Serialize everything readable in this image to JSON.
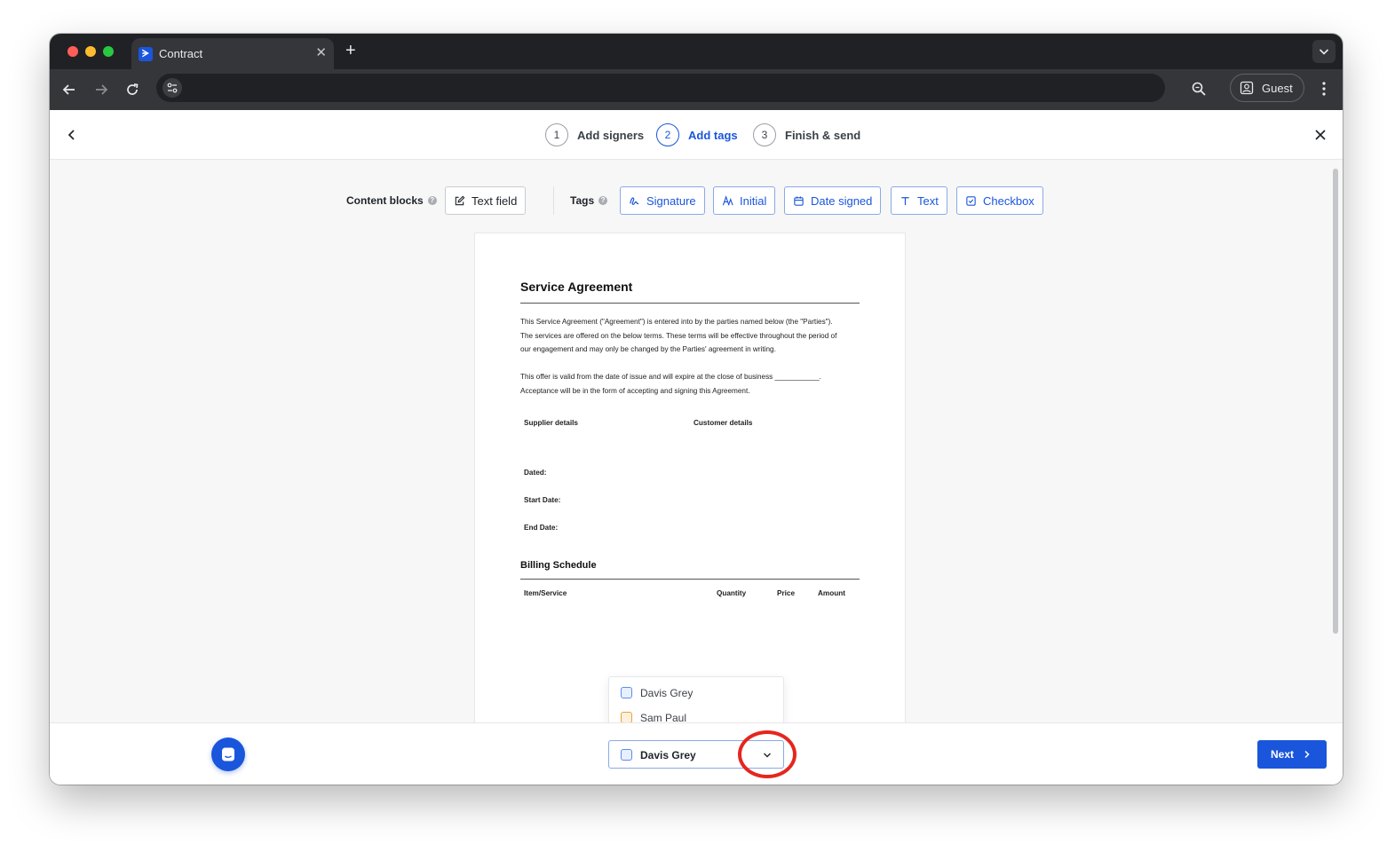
{
  "browser": {
    "tab_title": "Contract",
    "profile_label": "Guest",
    "close_glyph": "✕",
    "newtab_glyph": "+",
    "favicon_glyph": "ᗒ"
  },
  "wizard": {
    "steps": [
      {
        "number": "1",
        "label": "Add signers"
      },
      {
        "number": "2",
        "label": "Add tags"
      },
      {
        "number": "3",
        "label": "Finish & send"
      }
    ],
    "active_step": 2
  },
  "blocks": {
    "content_blocks_label": "Content blocks",
    "tags_label": "Tags",
    "help_glyph": "?",
    "text_field": "Text field",
    "signature": "Signature",
    "initial": "Initial",
    "date_signed": "Date signed",
    "text": "Text",
    "checkbox": "Checkbox"
  },
  "document": {
    "title": "Service Agreement",
    "para1": [
      "This Service Agreement (\"Agreement\") is entered into by the parties named below (the \"Parties\").",
      "The services are offered on the below terms. These terms will be effective throughout the period of",
      "our engagement and may only be changed by the Parties' agreement in writing."
    ],
    "para2": [
      "This offer is valid from the date of issue and will expire at the close of business ___________.",
      "Acceptance will be in the form of accepting and signing this Agreement."
    ],
    "supplier_details": "Supplier details",
    "customer_details": "Customer details",
    "dated": "Dated:",
    "start_date": "Start Date:",
    "end_date": "End Date:",
    "billing_schedule": "Billing Schedule",
    "table_headers": [
      "Item/Service",
      "Quantity",
      "Price",
      "Amount"
    ]
  },
  "signer_dropdown": {
    "options": [
      {
        "name": "Davis Grey",
        "color": "#3b82f6"
      },
      {
        "name": "Sam Paul",
        "color": "#f59e0b"
      }
    ],
    "selected": "Davis Grey"
  },
  "footer": {
    "next_label": "Next"
  },
  "colors": {
    "accent": "#1a56db",
    "annotation": "#e5261e"
  }
}
